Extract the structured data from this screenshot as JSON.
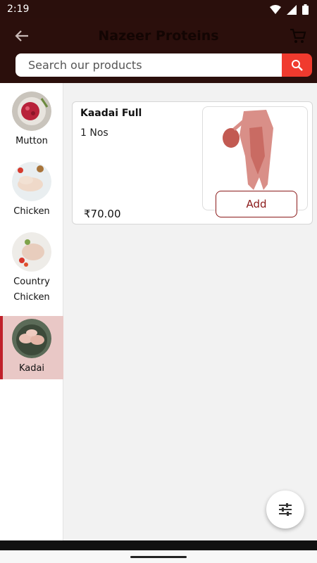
{
  "status": {
    "time": "2:19"
  },
  "header": {
    "title": "Nazeer Proteins",
    "back_icon": "arrow-left-icon",
    "cart_icon": "cart-icon"
  },
  "search": {
    "placeholder": "Search our products"
  },
  "sidebar": {
    "items": [
      {
        "label": "Mutton",
        "active": false
      },
      {
        "label": "Chicken",
        "active": false
      },
      {
        "label": "Country Chicken",
        "active": false
      },
      {
        "label": "Kadai",
        "active": true
      }
    ]
  },
  "product": {
    "name": "Kaadai Full",
    "quantity": "1 Nos",
    "price": "₹70.00",
    "add_label": "Add"
  },
  "colors": {
    "header": "#2b0f0c",
    "accent": "#f03a2e",
    "active_bg": "#e9c8c6",
    "active_bar": "#c0202a",
    "button_text": "#8b1a1a"
  }
}
